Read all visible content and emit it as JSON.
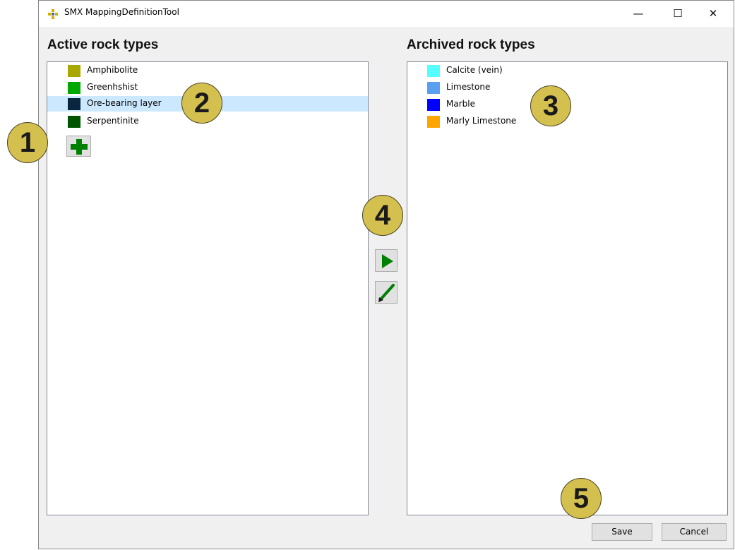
{
  "window": {
    "title": "SMX MappingDefinitionTool",
    "minimize_glyph": "—",
    "maximize_glyph": "☐",
    "close_glyph": "✕"
  },
  "active": {
    "heading": "Active rock types",
    "items": [
      {
        "label": "Amphibolite",
        "color": "#a8a800",
        "selected": false
      },
      {
        "label": "Greenhshist",
        "color": "#00a800",
        "selected": false
      },
      {
        "label": "Ore-bearing layer",
        "color": "#0b2440",
        "selected": true
      },
      {
        "label": "Serpentinite",
        "color": "#005400",
        "selected": false
      }
    ],
    "add_icon": "plus-icon"
  },
  "archived": {
    "heading": "Archived rock types",
    "items": [
      {
        "label": "Calcite (vein)",
        "color": "#55ffff"
      },
      {
        "label": "Limestone",
        "color": "#5aa0f0"
      },
      {
        "label": "Marble",
        "color": "#0000ff"
      },
      {
        "label": "Marly Limestone",
        "color": "#ffa500"
      }
    ]
  },
  "middle_buttons": {
    "move_icon": "play-arrow-icon",
    "edit_icon": "pencil-icon"
  },
  "footer": {
    "save_label": "Save",
    "cancel_label": "Cancel"
  },
  "callouts": [
    "1",
    "2",
    "3",
    "4",
    "5"
  ],
  "colors": {
    "accent_green": "#008000",
    "selection": "#cce8ff",
    "callout_fill": "#d4c04e"
  }
}
